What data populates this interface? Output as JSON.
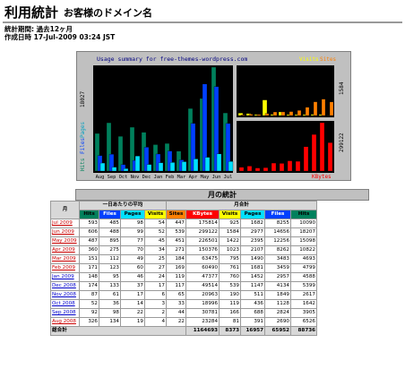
{
  "header": {
    "title": "利用統計",
    "subtitle": "お客様のドメイン名",
    "period_label": "統計期間: 過去12ヶ月",
    "generated_label": "作成日時  17-Jul-2009 03:24 JST"
  },
  "chart": {
    "title": "Usage summary for free-themes-wordpress.com",
    "legend_visits": "Visits",
    "legend_sites": "Sites",
    "legend_hits": "Hits",
    "legend_files": "Files",
    "legend_pages": "Pages",
    "kbytes_label": "KBytes",
    "left_max": "18027",
    "visits_max": "1584",
    "kbytes_max": "299122",
    "months": [
      "Aug",
      "Sep",
      "Oct",
      "Nov",
      "Dec",
      "Jan",
      "Feb",
      "Mar",
      "Apr",
      "May",
      "Jun",
      "Jul"
    ],
    "colors": {
      "hits": "#00805c",
      "files": "#0040ff",
      "pages": "#00e0ff",
      "visits": "#ffff00",
      "sites": "#ff8000",
      "kbytes": "#ff0000"
    }
  },
  "chart_data": {
    "type": "bar",
    "title": "Usage summary for free-themes-wordpress.com",
    "categories": [
      "Aug",
      "Sep",
      "Oct",
      "Nov",
      "Dec",
      "Jan",
      "Feb",
      "Mar",
      "Apr",
      "May",
      "Jun",
      "Jul"
    ],
    "series": [
      {
        "name": "Hits",
        "values": [
          6526,
          8383,
          6034,
          7611,
          6736,
          4588,
          4799,
          3459,
          10862,
          12598,
          18027,
          10090
        ]
      },
      {
        "name": "Files",
        "values": [
          2690,
          2929,
          1128,
          1849,
          4134,
          2957,
          3483,
          1941,
          8262,
          15098,
          14656,
          8255
        ]
      },
      {
        "name": "Pages",
        "values": [
          1391,
          688,
          436,
          2617,
          1147,
          1452,
          1490,
          1631,
          2107,
          2395,
          2977,
          1682
        ]
      },
      {
        "name": "Visits",
        "values": [
          81,
          68,
          36,
          511,
          41,
          119,
          34,
          33,
          35,
          41,
          39,
          11
        ]
      },
      {
        "name": "Sites",
        "values": [
          22,
          44,
          33,
          65,
          117,
          119,
          130,
          169,
          271,
          451,
          539,
          447
        ]
      },
      {
        "name": "KBytes",
        "values": [
          23284,
          30781,
          18996,
          20963,
          49514,
          47377,
          63475,
          60490,
          150376,
          226501,
          299122,
          175814
        ]
      }
    ],
    "ylim_left": [
      0,
      18027
    ],
    "ylim_visits": [
      0,
      1584
    ],
    "ylim_kbytes": [
      0,
      299122
    ]
  },
  "stats_title": "月の統計",
  "table": {
    "col_month": "月",
    "group_daily": "一日あたりの平均",
    "group_monthly": "月合計",
    "col_hits": "Hits",
    "col_files": "Files",
    "col_pages": "Pages",
    "col_visits": "Visits",
    "col_sites": "Sites",
    "col_kbytes": "KBytes",
    "rows": [
      {
        "month": "Jul 2009",
        "red": true,
        "h": "593",
        "f": "485",
        "p": "98",
        "v": "54",
        "sites": "447",
        "kb": "175814",
        "mv": "925",
        "mp": "1682",
        "mf": "8255",
        "mh": "10090"
      },
      {
        "month": "Jun 2009",
        "red": true,
        "h": "606",
        "f": "488",
        "p": "99",
        "v": "52",
        "sites": "539",
        "kb": "299122",
        "mv": "1584",
        "mp": "2977",
        "mf": "14656",
        "mh": "18207"
      },
      {
        "month": "May 2009",
        "red": true,
        "h": "487",
        "f": "895",
        "p": "77",
        "v": "45",
        "sites": "451",
        "kb": "226501",
        "mv": "1422",
        "mp": "2395",
        "mf": "12256",
        "mh": "15098"
      },
      {
        "month": "Apr 2009",
        "red": true,
        "h": "360",
        "f": "275",
        "p": "70",
        "v": "34",
        "sites": "271",
        "kb": "150376",
        "mv": "1023",
        "mp": "2107",
        "mf": "8262",
        "mh": "10822"
      },
      {
        "month": "Mar 2009",
        "red": true,
        "h": "151",
        "f": "112",
        "p": "49",
        "v": "25",
        "sites": "184",
        "kb": "63475",
        "mv": "795",
        "mp": "1490",
        "mf": "3483",
        "mh": "4693"
      },
      {
        "month": "Feb 2009",
        "red": true,
        "h": "171",
        "f": "123",
        "p": "60",
        "v": "27",
        "sites": "169",
        "kb": "60490",
        "mv": "761",
        "mp": "1681",
        "mf": "3459",
        "mh": "4799"
      },
      {
        "month": "Jan 2009",
        "red": false,
        "h": "148",
        "f": "95",
        "p": "46",
        "v": "24",
        "sites": "119",
        "kb": "47377",
        "mv": "760",
        "mp": "1452",
        "mf": "2957",
        "mh": "4588"
      },
      {
        "month": "Dec 2008",
        "red": false,
        "h": "174",
        "f": "133",
        "p": "37",
        "v": "17",
        "sites": "117",
        "kb": "49514",
        "mv": "539",
        "mp": "1147",
        "mf": "4134",
        "mh": "5399"
      },
      {
        "month": "Nov 2008",
        "red": false,
        "h": "87",
        "f": "61",
        "p": "17",
        "v": "6",
        "sites": "65",
        "kb": "20963",
        "mv": "190",
        "mp": "511",
        "mf": "1849",
        "mh": "2617"
      },
      {
        "month": "Oct 2008",
        "red": false,
        "h": "52",
        "f": "36",
        "p": "14",
        "v": "3",
        "sites": "33",
        "kb": "18996",
        "mv": "119",
        "mp": "436",
        "mf": "1128",
        "mh": "1642"
      },
      {
        "month": "Sep 2008",
        "red": false,
        "h": "92",
        "f": "98",
        "p": "22",
        "v": "2",
        "sites": "44",
        "kb": "30781",
        "mv": "166",
        "mp": "688",
        "mf": "2824",
        "mh": "3905"
      },
      {
        "month": "Aug 2008",
        "red": true,
        "h": "326",
        "f": "134",
        "p": "19",
        "v": "4",
        "sites": "22",
        "kb": "23284",
        "mv": "81",
        "mp": "391",
        "mf": "2690",
        "mh": "6526"
      }
    ],
    "total_label": "総合計",
    "total": {
      "kb": "1164693",
      "mv": "8373",
      "mp": "16957",
      "mf": "65952",
      "mh": "88736"
    }
  }
}
